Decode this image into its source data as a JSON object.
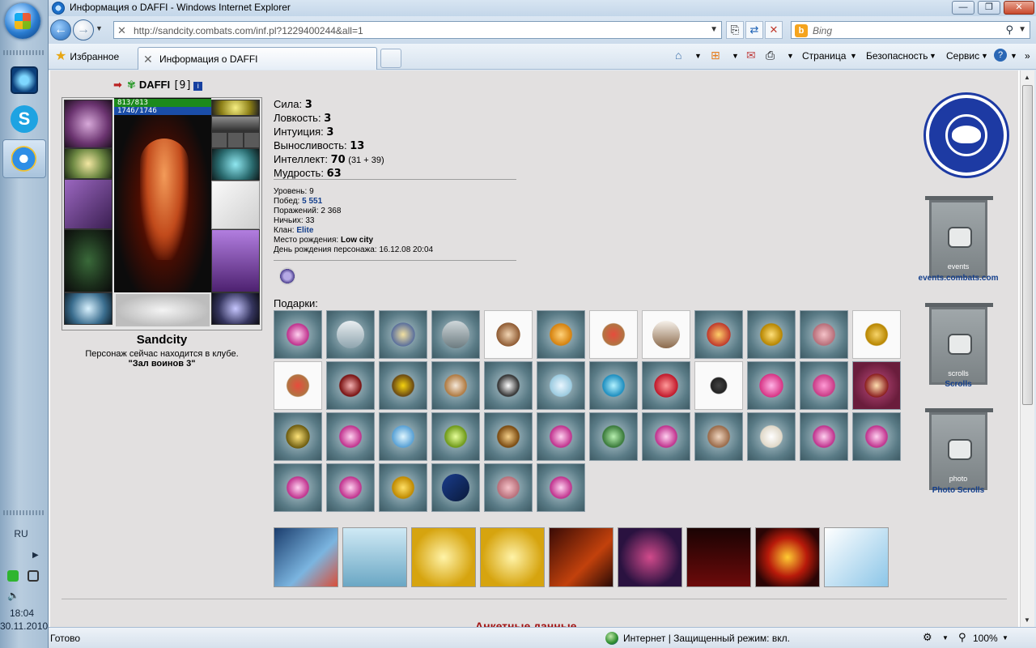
{
  "taskbar": {
    "lang": "RU",
    "time": "18:04",
    "date": "30.11.2010"
  },
  "window": {
    "title": "Информация о DAFFI - Windows Internet Explorer",
    "minimize": "—",
    "maximize": "❐",
    "close": "✕"
  },
  "navbar": {
    "url": "http://sandcity.combats.com/inf.pl?1229400244&all=1",
    "search_placeholder": "Bing"
  },
  "cmdbar": {
    "favorites": "Избранное",
    "tab_title": "Информация о DAFFI",
    "page_menu": "Страница",
    "safety_menu": "Безопасность",
    "tools_menu": "Сервис"
  },
  "character": {
    "name": "DAFFI",
    "level": "[9]",
    "hp": "813/813",
    "mana": "1746/1746",
    "city": "Sandcity",
    "status_line": "Персонаж сейчас находится в клубе.",
    "room": "\"Зал воинов 3\""
  },
  "stats": [
    {
      "label": "Сила:",
      "value": "3",
      "extra": ""
    },
    {
      "label": "Ловкость:",
      "value": "3",
      "extra": ""
    },
    {
      "label": "Интуиция:",
      "value": "3",
      "extra": ""
    },
    {
      "label": "Выносливость:",
      "value": "13",
      "extra": ""
    },
    {
      "label": "Интеллект:",
      "value": "70",
      "extra": "(31 + 39)"
    },
    {
      "label": "Мудрость:",
      "value": "63",
      "extra": ""
    }
  ],
  "details": {
    "level": "Уровень: 9",
    "wins_label": "Побед:",
    "wins": "5 551",
    "losses": "Поражений: 2 368",
    "draws": "Ничьих: 33",
    "clan_label": "Клан:",
    "clan": "Elite",
    "birthplace_label": "Место рождения:",
    "birthplace": "Low city",
    "birthday": "День рождения персонажа: 16.12.08 20:04"
  },
  "gifts_title": "Подарки:",
  "emblems": {
    "events_caption": "events",
    "events_link": "events.combats.com",
    "scrolls_caption": "scrolls",
    "scrolls_link": "Scrolls",
    "photo_caption": "photo",
    "photo_link": "Photo Scrolls"
  },
  "next_heading": "Анкетные данные",
  "status": {
    "text": "Готово",
    "zone": "Интернет | Защищенный режим: вкл.",
    "zoom": "100%"
  }
}
